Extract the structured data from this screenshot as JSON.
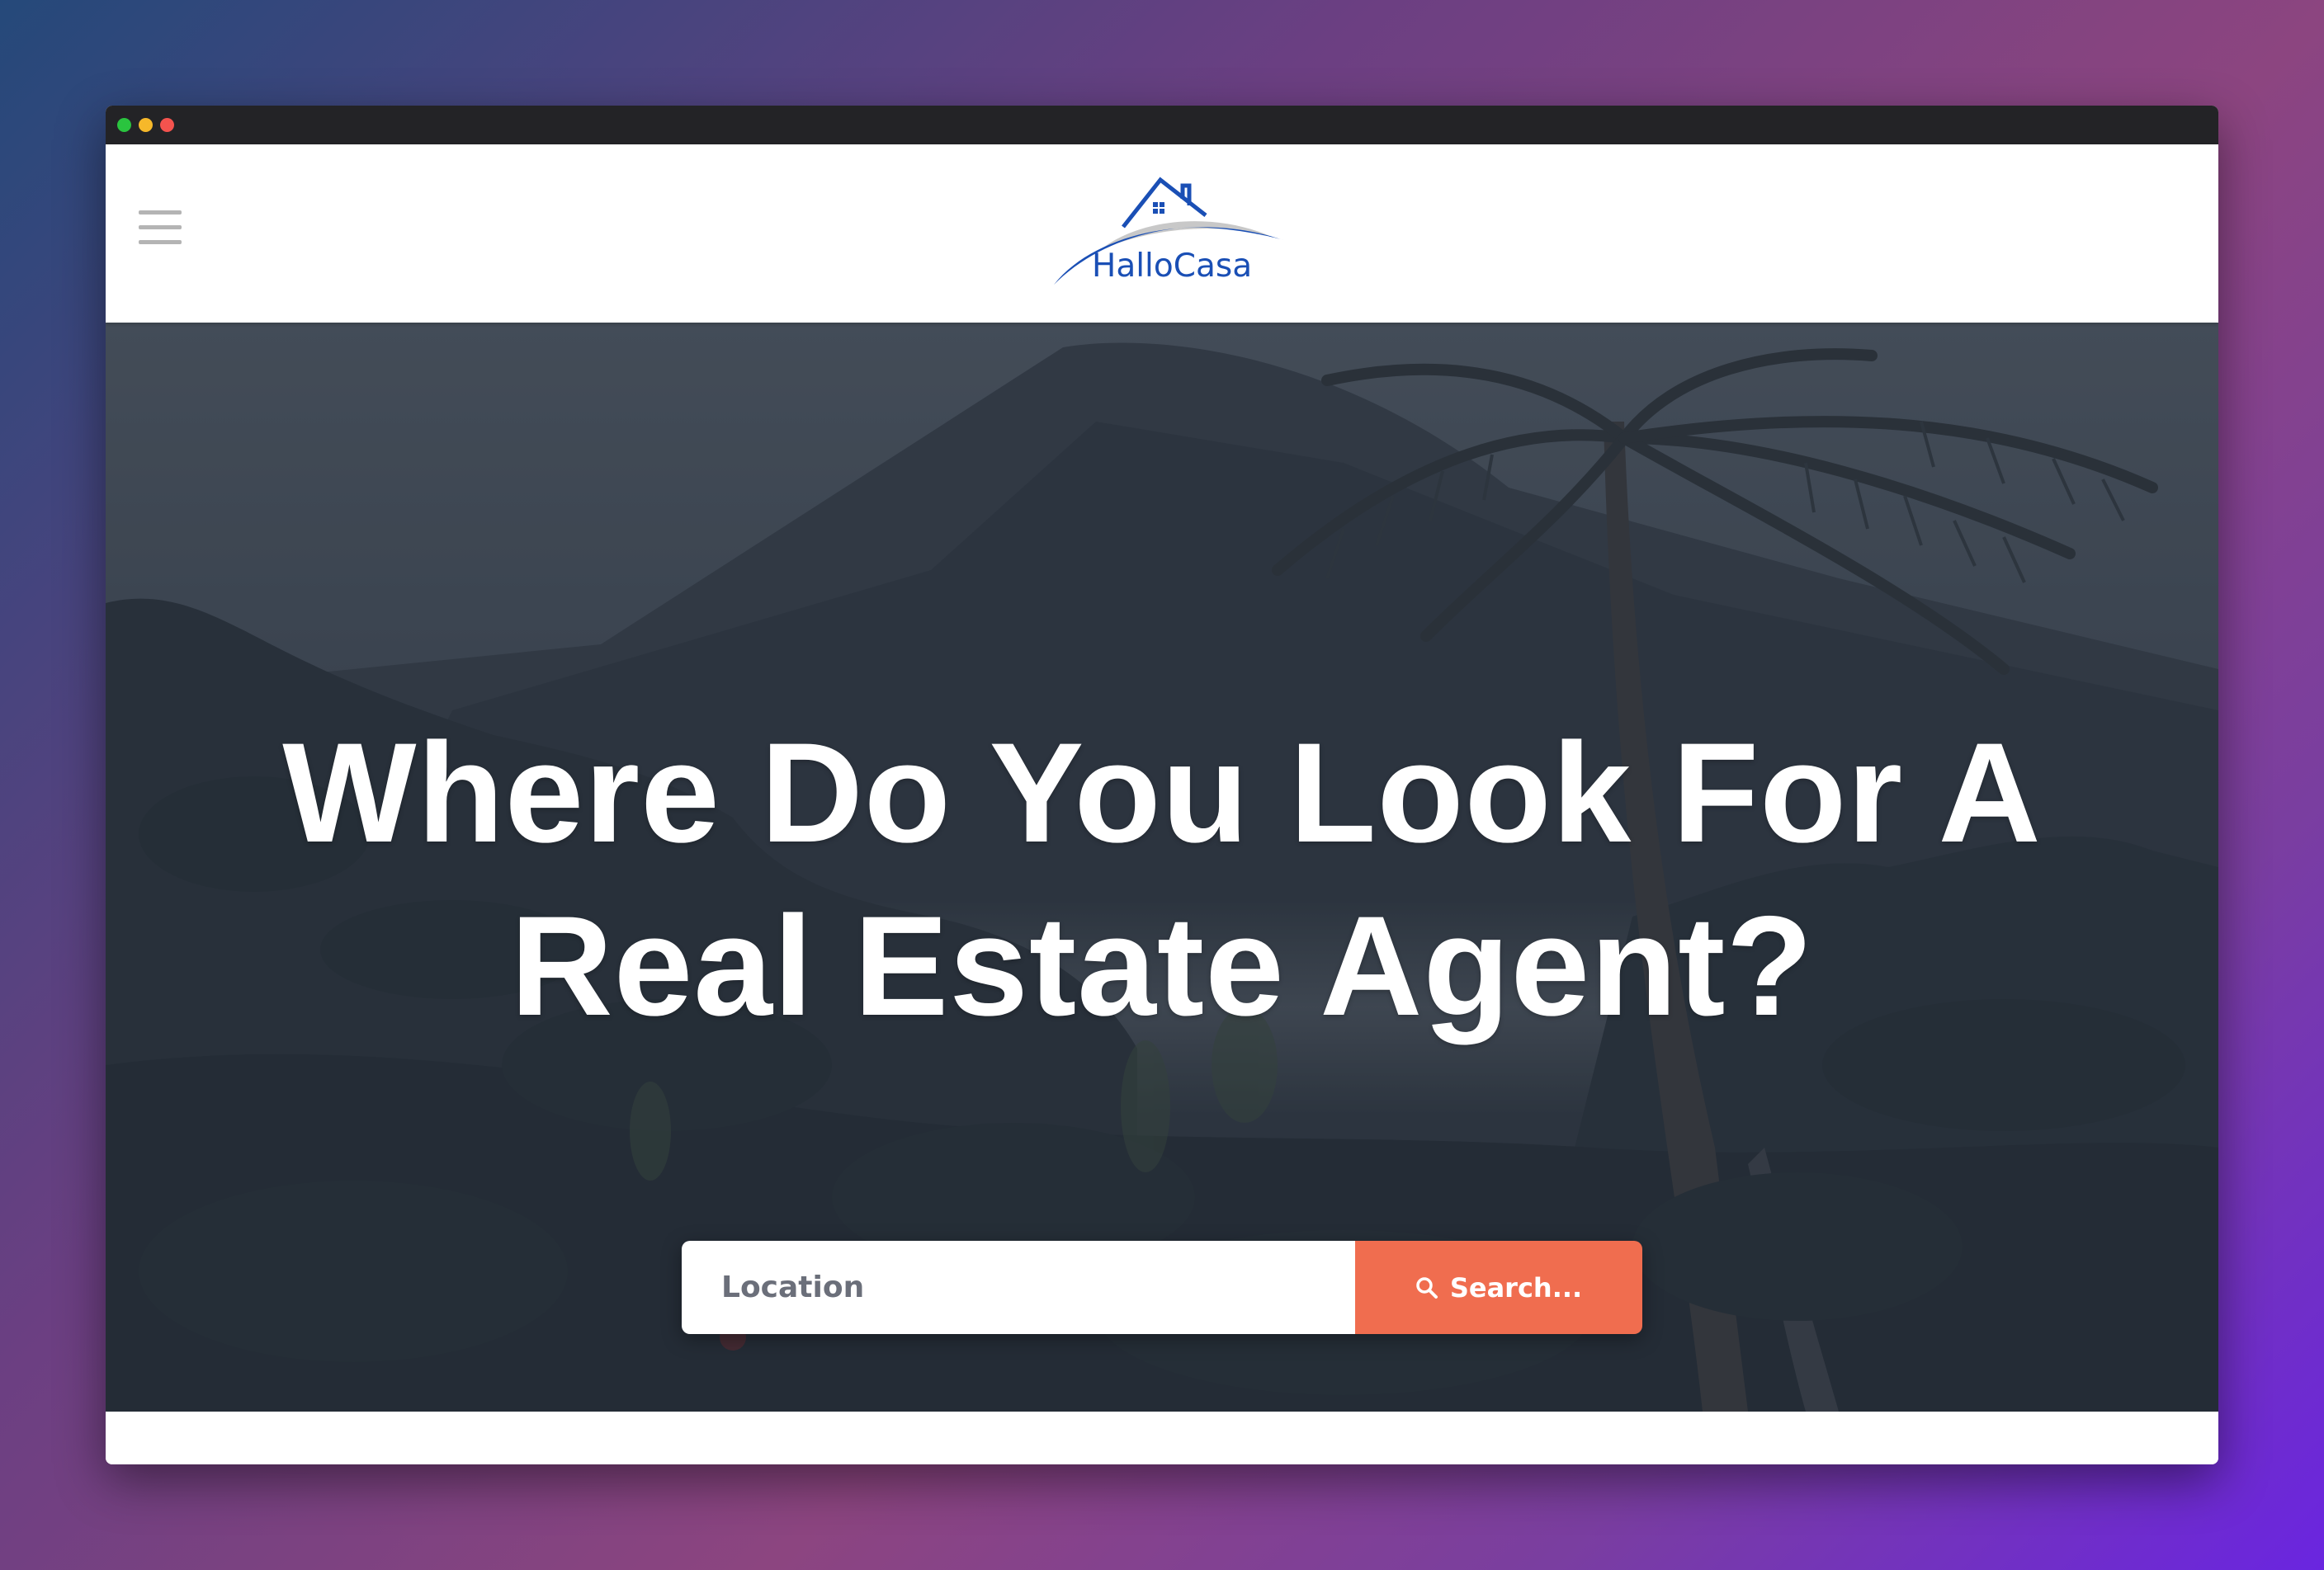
{
  "window": {
    "controls": [
      "green",
      "yellow",
      "red"
    ]
  },
  "header": {
    "menu_icon": "hamburger-menu-icon",
    "logo_text": "HalloCasa",
    "logo_colors": {
      "primary": "#1a4fb5",
      "swoosh_gray": "#c8c8c8"
    }
  },
  "hero": {
    "title": "Where Do You Look For A Real Estate Agent?",
    "search": {
      "placeholder": "Location",
      "value": "",
      "button_label": "Search...",
      "button_icon": "search-icon",
      "button_color": "#f06d4f"
    }
  }
}
